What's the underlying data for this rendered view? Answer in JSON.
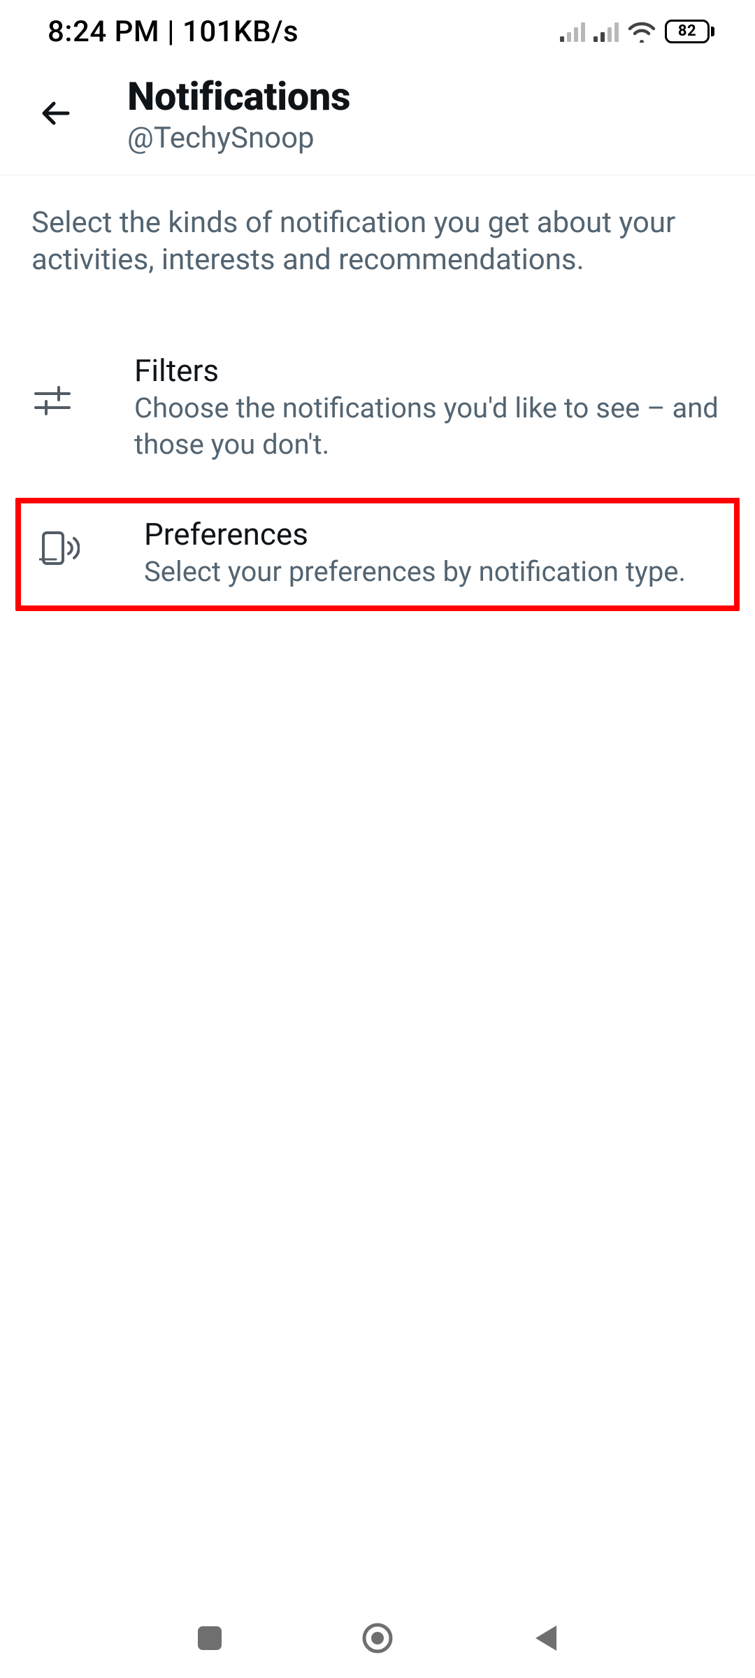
{
  "status_bar": {
    "time_text": "8:24 PM | 101KB/s",
    "battery_pct": "82"
  },
  "header": {
    "title": "Notifications",
    "handle": "@TechySnoop"
  },
  "description": "Select the kinds of notification you get about your activities, interests and recommendations.",
  "options": {
    "filters": {
      "title": "Filters",
      "desc": "Choose the notifications you'd like to see – and those you don't."
    },
    "preferences": {
      "title": "Preferences",
      "desc": "Select your preferences by notification type."
    }
  }
}
